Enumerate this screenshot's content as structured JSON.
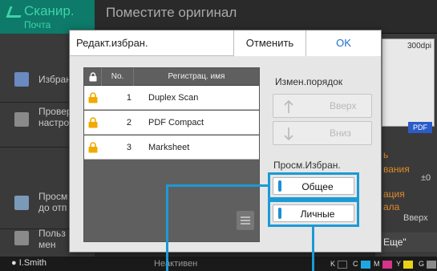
{
  "app": {
    "name": "Сканир.",
    "subtitle": "Почта",
    "background_title": "Поместите оригинал"
  },
  "left_menu": [
    {
      "label": "Избран",
      "icon": "favorites-icon"
    },
    {
      "label": "Провер\nнастро",
      "icon": "list-icon"
    },
    {
      "label": "Просм\nдо отп",
      "icon": "preview-doc-icon"
    },
    {
      "label": "Польз\nмен",
      "icon": "wrench-icon"
    }
  ],
  "right_panel": {
    "dpi": "300dpi",
    "format_badge": "PDF",
    "item1": "ь\nвания",
    "item1_value": "±0",
    "item2": "ация\nала",
    "item2_value": "Вверх",
    "more_label": "Еще\""
  },
  "status_bar": {
    "user": "I.Smith",
    "state": "Неактивен",
    "inks": [
      {
        "label": "K",
        "color": "#1a1a1a"
      },
      {
        "label": "C",
        "color": "#1fa8e0"
      },
      {
        "label": "M",
        "color": "#d6338a"
      },
      {
        "label": "Y",
        "color": "#e8d21a"
      },
      {
        "label": "G",
        "color": "#8a8a8a"
      }
    ]
  },
  "dialog": {
    "title": "Редакт.избран.",
    "cancel_label": "Отменить",
    "ok_label": "OK",
    "table": {
      "col_no": "No.",
      "col_name": "Регистрац. имя",
      "rows": [
        {
          "no": "1",
          "name": "Duplex Scan",
          "locked": true
        },
        {
          "no": "2",
          "name": "PDF Compact",
          "locked": true
        },
        {
          "no": "3",
          "name": "Marksheet",
          "locked": true
        }
      ]
    },
    "reorder_label": "Измен.порядок",
    "up_label": "Вверх",
    "down_label": "Вниз",
    "view_label": "Просм.Избран.",
    "common_label": "Общее",
    "personal_label": "Личные"
  },
  "colors": {
    "accent": "#1b9ad6",
    "ok_text": "#1a6fd4",
    "lock": "#f2a900",
    "app_teal": "#0d7a6a"
  }
}
